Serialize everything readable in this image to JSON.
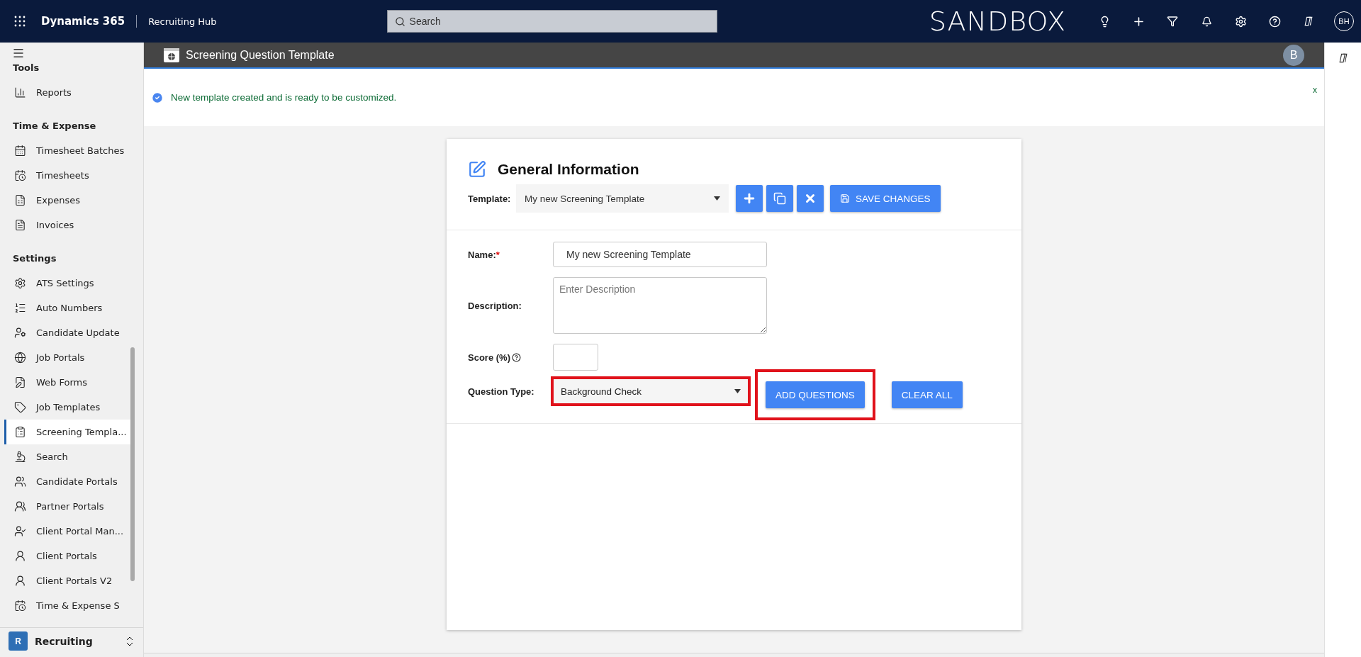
{
  "top_bar": {
    "app_name": "Dynamics 365",
    "area_name": "Recruiting Hub",
    "search": {
      "placeholder": "Search"
    },
    "environment": "SANDBOX",
    "user_initials": "BH"
  },
  "sidebar": {
    "groups": [
      {
        "title": "Tools",
        "items": [
          {
            "label": "Reports",
            "selected": false
          }
        ]
      },
      {
        "title": "Time & Expense",
        "items": [
          {
            "label": "Timesheet Batches",
            "selected": false
          },
          {
            "label": "Timesheets",
            "selected": false
          },
          {
            "label": "Expenses",
            "selected": false
          },
          {
            "label": "Invoices",
            "selected": false
          }
        ]
      },
      {
        "title": "Settings",
        "items": [
          {
            "label": "ATS Settings",
            "selected": false
          },
          {
            "label": "Auto Numbers",
            "selected": false
          },
          {
            "label": "Candidate Update",
            "selected": false
          },
          {
            "label": "Job Portals",
            "selected": false
          },
          {
            "label": "Web Forms",
            "selected": false
          },
          {
            "label": "Job Templates",
            "selected": false
          },
          {
            "label": "Screening Templa...",
            "selected": true
          },
          {
            "label": "Search",
            "selected": false
          },
          {
            "label": "Candidate Portals",
            "selected": false
          },
          {
            "label": "Partner Portals",
            "selected": false
          },
          {
            "label": "Client Portal Man...",
            "selected": false
          },
          {
            "label": "Client Portals",
            "selected": false
          },
          {
            "label": "Client Portals V2",
            "selected": false
          },
          {
            "label": "Time & Expense S",
            "selected": false
          }
        ]
      }
    ],
    "area_switcher": {
      "badge": "R",
      "label": "Recruiting"
    }
  },
  "page_header": {
    "title": "Screening Question Template",
    "avatar": "B"
  },
  "notification": {
    "message": "New template created and is ready to be customized.",
    "close": "x"
  },
  "form": {
    "title": "General Information",
    "template_label": "Template:",
    "template_value": "My new Screening Template",
    "save_button": "SAVE CHANGES",
    "name_label": "Name:",
    "name_required": "*",
    "name_value": "My new Screening Template",
    "description_label": "Description:",
    "description_placeholder": "Enter Description",
    "score_label": "Score (%)",
    "question_type_label": "Question Type:",
    "question_type": {
      "value": "Background Check",
      "highlighted": true
    },
    "add_button": {
      "label": "ADD QUESTIONS",
      "highlighted": true
    },
    "clear_button": {
      "label": "CLEAR ALL",
      "highlighted": false
    }
  }
}
